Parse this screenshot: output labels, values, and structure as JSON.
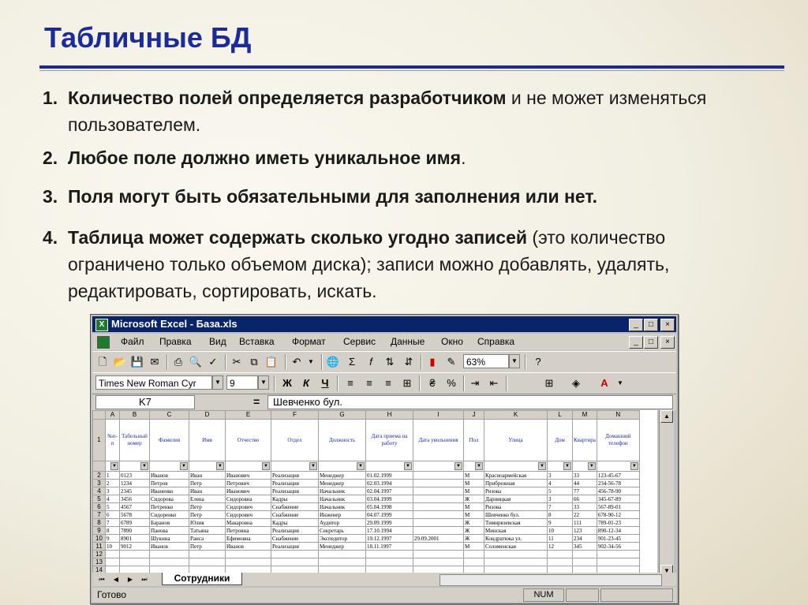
{
  "slide": {
    "title": "Табличные БД",
    "items": [
      {
        "num": "1.",
        "bold": "Количество полей определяется разработчиком",
        "rest": " и не может изменяться пользователем."
      },
      {
        "num": "2.",
        "bold": "Любое поле должно иметь уникальное имя",
        "rest": "."
      },
      {
        "num": "3.",
        "bold": "Поля могут быть обязательными для заполнения или нет.",
        "rest": ""
      },
      {
        "num": "4.",
        "bold": "Таблица может содержать сколько угодно записей",
        "rest": " (это количество ограничено только объемом диска); записи можно добавлять, удалять, редактировать, сортировать, искать."
      }
    ]
  },
  "excel": {
    "window_title": "Microsoft Excel - База.xls",
    "title_buttons": [
      "_",
      "□",
      "×"
    ],
    "menu": [
      "Файл",
      "Правка",
      "Вид",
      "Вставка",
      "Формат",
      "Сервис",
      "Данные",
      "Окно",
      "Справка"
    ],
    "zoom": "63%",
    "font_name": "Times New Roman Cyr",
    "font_size": "9",
    "format_buttons": [
      "Ж",
      "К",
      "Ч"
    ],
    "name_box": "K7",
    "formula_equals": "=",
    "formula_value": "Шевченко бул.",
    "columns": [
      "A",
      "B",
      "C",
      "D",
      "E",
      "F",
      "G",
      "H",
      "I",
      "J",
      "K",
      "L",
      "M",
      "N"
    ],
    "headers": [
      "№п-п",
      "Табельный номер",
      "Фамилия",
      "Имя",
      "Отчество",
      "Отдел",
      "Должность",
      "Дата приема на работу",
      "Дата увольнения",
      "Пол",
      "Улица",
      "Дом",
      "Квартира",
      "Домашний телефон"
    ],
    "rows": [
      {
        "r": "2",
        "cells": [
          "1",
          "0123",
          "Иванов",
          "Иван",
          "Иванович",
          "Реализация",
          "Менеджер",
          "01.02.1999",
          "",
          "М",
          "Красноармейская",
          "3",
          "33",
          "123-45-67"
        ]
      },
      {
        "r": "3",
        "cells": [
          "2",
          "1234",
          "Петров",
          "Петр",
          "Петрович",
          "Реализация",
          "Менеджер",
          "02.03.1994",
          "",
          "М",
          "Прибрежная",
          "4",
          "44",
          "234-56-78"
        ]
      },
      {
        "r": "4",
        "cells": [
          "3",
          "2345",
          "Иваненко",
          "Иван",
          "Иванович",
          "Реализация",
          "Начальник",
          "02.04.1997",
          "",
          "М",
          "Ризова",
          "5",
          "77",
          "456-78-90"
        ]
      },
      {
        "r": "5",
        "cells": [
          "4",
          "3456",
          "Сидорова",
          "Елена",
          "Сидоровна",
          "Кадры",
          "Начальник",
          "03.04.1999",
          "",
          "Ж",
          "Дарницкая",
          "3",
          "66",
          "345-67-89"
        ]
      },
      {
        "r": "6",
        "cells": [
          "5",
          "4567",
          "Петренко",
          "Петр",
          "Сидорович",
          "Снабжение",
          "Начальник",
          "05.04.1998",
          "",
          "М",
          "Ризова",
          "7",
          "33",
          "567-89-01"
        ]
      },
      {
        "r": "7",
        "cells": [
          "6",
          "5678",
          "Сидоренко",
          "Петр",
          "Сидорович",
          "Снабжение",
          "Инженер",
          "04.07.1999",
          "",
          "М",
          "Шевченко бул.",
          "8",
          "22",
          "678-90-12"
        ]
      },
      {
        "r": "8",
        "cells": [
          "7",
          "6789",
          "Баранов",
          "Юлия",
          "Макаровна",
          "Кадры",
          "Аудитор",
          "29.09.1999",
          "",
          "Ж",
          "Тимирязевская",
          "9",
          "111",
          "789-01-23"
        ]
      },
      {
        "r": "9",
        "cells": [
          "8",
          "7890",
          "Панова",
          "Татьяна",
          "Петровна",
          "Реализация",
          "Секретарь",
          "17.10.1994",
          "",
          "Ж",
          "Минская",
          "10",
          "123",
          "890-12-34"
        ]
      },
      {
        "r": "10",
        "cells": [
          "9",
          "8901",
          "Шукина",
          "Раиса",
          "Ефимовна",
          "Снабжение",
          "Экспедитор",
          "19.12.1997",
          "29.09.2001",
          "Ж",
          "Кондратюка ул.",
          "11",
          "234",
          "901-23-45"
        ]
      },
      {
        "r": "11",
        "cells": [
          "10",
          "9012",
          "Иванов",
          "Петр",
          "Иванов",
          "Реализация",
          "Менеджер",
          "18.11.1997",
          "",
          "М",
          "Соломенская",
          "12",
          "345",
          "902-34-56"
        ]
      },
      {
        "r": "12",
        "cells": [
          "",
          "",
          "",
          "",
          "",
          "",
          "",
          "",
          "",
          "",
          "",
          "",
          "",
          ""
        ]
      },
      {
        "r": "13",
        "cells": [
          "",
          "",
          "",
          "",
          "",
          "",
          "",
          "",
          "",
          "",
          "",
          "",
          "",
          ""
        ]
      },
      {
        "r": "14",
        "cells": [
          "",
          "",
          "",
          "",
          "",
          "",
          "",
          "",
          "",
          "",
          "",
          "",
          "",
          ""
        ]
      }
    ],
    "sheet_tab": "Сотрудники",
    "status_text": "Готово",
    "status_num": "NUM",
    "colors": {
      "title_bar": "#0a246a",
      "slide_title": "#1b2b9a",
      "header_text": "#1b2b9a"
    }
  }
}
